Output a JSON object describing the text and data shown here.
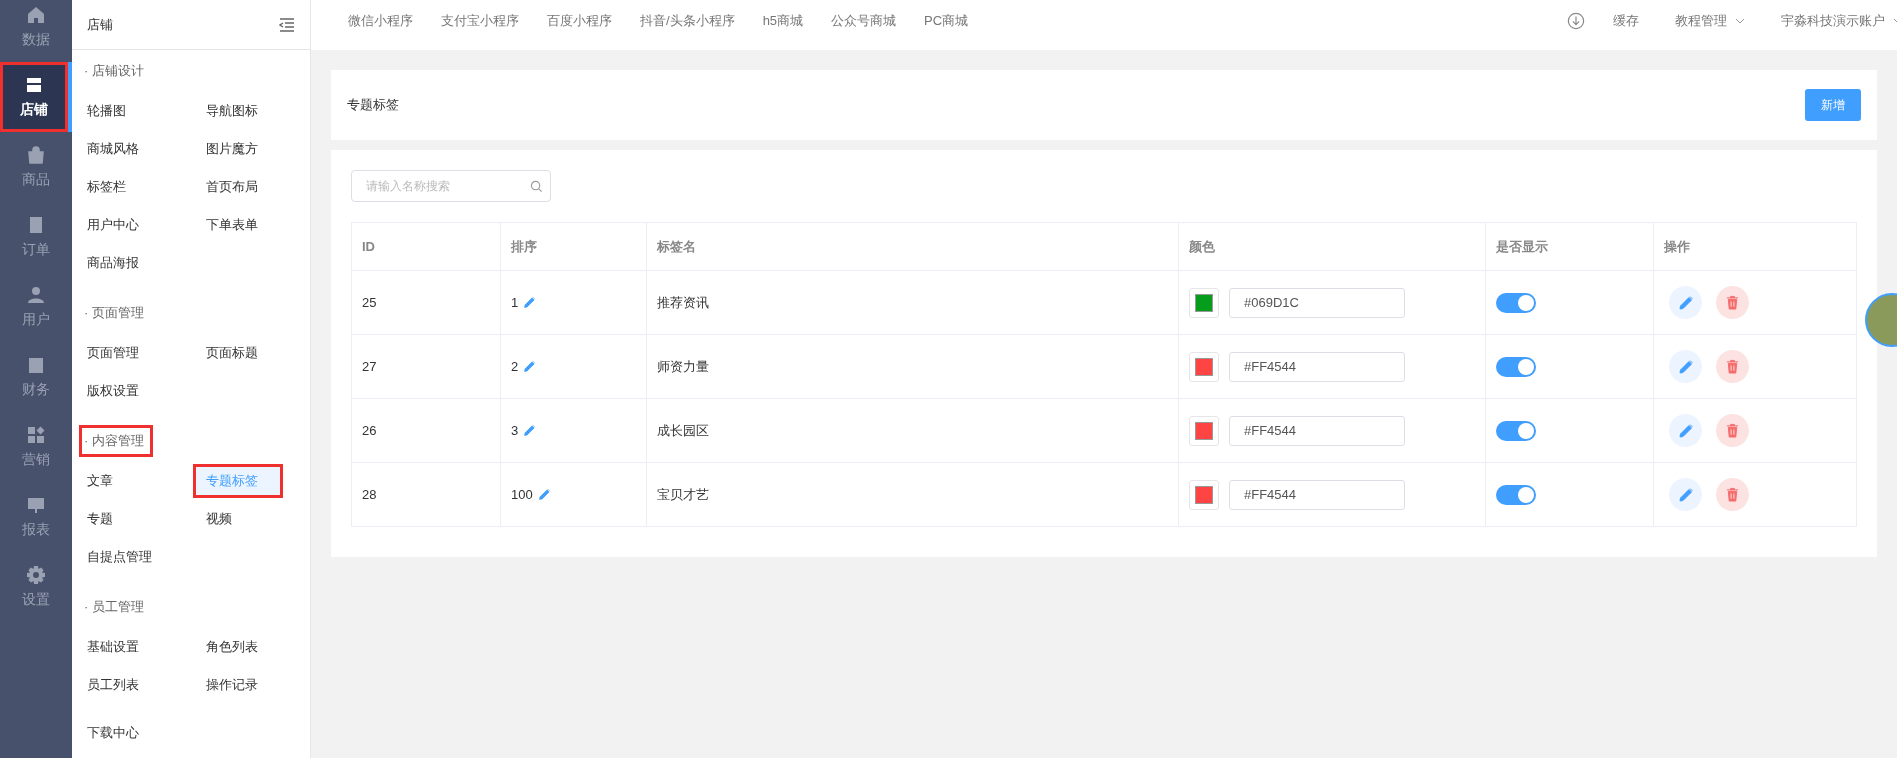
{
  "rail": [
    {
      "label": "数据",
      "selected": false,
      "highlighted": false
    },
    {
      "label": "店铺",
      "selected": true,
      "highlighted": true
    },
    {
      "label": "商品",
      "selected": false,
      "highlighted": false
    },
    {
      "label": "订单",
      "selected": false,
      "highlighted": false
    },
    {
      "label": "用户",
      "selected": false,
      "highlighted": false
    },
    {
      "label": "财务",
      "selected": false,
      "highlighted": false
    },
    {
      "label": "营销",
      "selected": false,
      "highlighted": false
    },
    {
      "label": "报表",
      "selected": false,
      "highlighted": false
    },
    {
      "label": "设置",
      "selected": false,
      "highlighted": false
    }
  ],
  "submenu": {
    "title": "店铺",
    "groups": [
      {
        "title": "· 店铺设计",
        "highlighted": false,
        "items": [
          {
            "label": "轮播图",
            "selected": false,
            "highlighted": false
          },
          {
            "label": "导航图标",
            "selected": false,
            "highlighted": false
          },
          {
            "label": "商城风格",
            "selected": false,
            "highlighted": false
          },
          {
            "label": "图片魔方",
            "selected": false,
            "highlighted": false
          },
          {
            "label": "标签栏",
            "selected": false,
            "highlighted": false
          },
          {
            "label": "首页布局",
            "selected": false,
            "highlighted": false
          },
          {
            "label": "用户中心",
            "selected": false,
            "highlighted": false
          },
          {
            "label": "下单表单",
            "selected": false,
            "highlighted": false
          },
          {
            "label": "商品海报",
            "selected": false,
            "highlighted": false
          }
        ]
      },
      {
        "title": "· 页面管理",
        "highlighted": false,
        "items": [
          {
            "label": "页面管理",
            "selected": false,
            "highlighted": false
          },
          {
            "label": "页面标题",
            "selected": false,
            "highlighted": false
          },
          {
            "label": "版权设置",
            "selected": false,
            "highlighted": false
          }
        ]
      },
      {
        "title": "· 内容管理",
        "highlighted": true,
        "items": [
          {
            "label": "文章",
            "selected": false,
            "highlighted": false
          },
          {
            "label": "专题标签",
            "selected": true,
            "highlighted": true
          },
          {
            "label": "专题",
            "selected": false,
            "highlighted": false
          },
          {
            "label": "视频",
            "selected": false,
            "highlighted": false
          },
          {
            "label": "自提点管理",
            "selected": false,
            "highlighted": false
          }
        ]
      },
      {
        "title": "· 员工管理",
        "highlighted": false,
        "items": [
          {
            "label": "基础设置",
            "selected": false,
            "highlighted": false
          },
          {
            "label": "角色列表",
            "selected": false,
            "highlighted": false
          },
          {
            "label": "员工列表",
            "selected": false,
            "highlighted": false
          },
          {
            "label": "操作记录",
            "selected": false,
            "highlighted": false
          }
        ]
      },
      {
        "items": [
          {
            "label": "下载中心",
            "selected": false,
            "highlighted": false
          }
        ]
      }
    ]
  },
  "topbar": {
    "tabs": [
      "微信小程序",
      "支付宝小程序",
      "百度小程序",
      "抖音/头条小程序",
      "h5商城",
      "公众号商城",
      "PC商城"
    ],
    "cache": "缓存",
    "menus": [
      "教程管理",
      "宇淼科技演示账户"
    ]
  },
  "page_header": {
    "title": "专题标签",
    "add_button": "新增"
  },
  "search": {
    "placeholder": "请输入名称搜索"
  },
  "table": {
    "columns": [
      "ID",
      "排序",
      "标签名",
      "颜色",
      "是否显示",
      "操作"
    ],
    "rows": [
      {
        "id": "25",
        "sort": "1",
        "name": "推荐资讯",
        "color": "#069d1c",
        "color_text": "#069D1C",
        "on": true
      },
      {
        "id": "27",
        "sort": "2",
        "name": "师资力量",
        "color": "#ff4544",
        "color_text": "#FF4544",
        "on": true
      },
      {
        "id": "26",
        "sort": "3",
        "name": "成长园区",
        "color": "#ff4544",
        "color_text": "#FF4544",
        "on": true
      },
      {
        "id": "28",
        "sort": "100",
        "name": "宝贝才艺",
        "color": "#ff4544",
        "color_text": "#FF4544",
        "on": true
      }
    ]
  }
}
